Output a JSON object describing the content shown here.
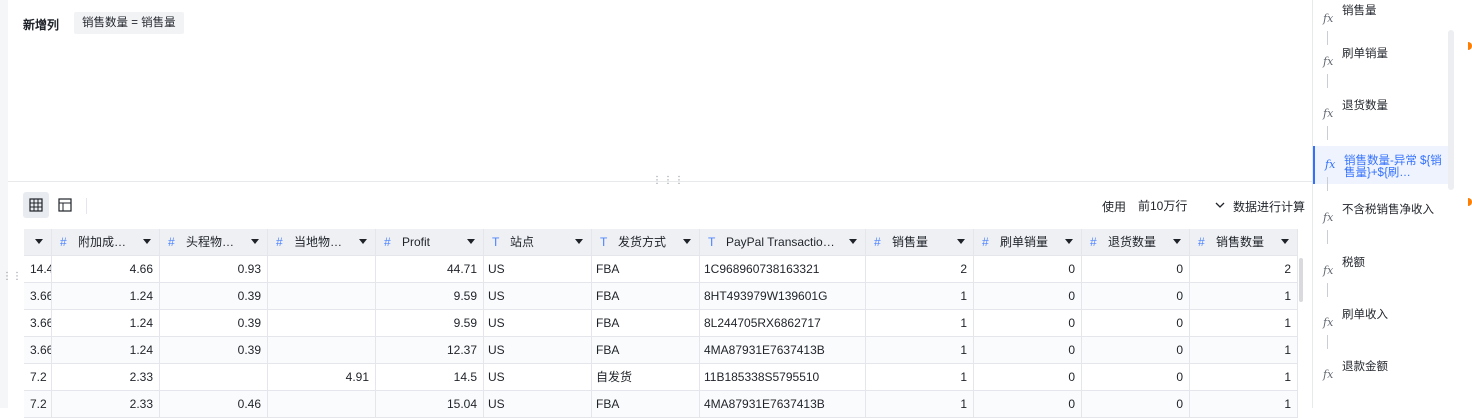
{
  "formula": {
    "label": "新增列",
    "expression": "销售数量 = 销售量"
  },
  "toolbar": {
    "use_label": "使用",
    "select_value": "前10万行",
    "calc_label": "数据进行计算"
  },
  "columns": [
    {
      "name": "",
      "type": "none",
      "align": "num"
    },
    {
      "name": "附加成…",
      "type": "number",
      "align": "num"
    },
    {
      "name": "头程物…",
      "type": "number",
      "align": "num"
    },
    {
      "name": "当地物…",
      "type": "number",
      "align": "num"
    },
    {
      "name": "Profit",
      "type": "number",
      "align": "num"
    },
    {
      "name": "站点",
      "type": "text",
      "align": "txt"
    },
    {
      "name": "发货方式",
      "type": "text",
      "align": "txt"
    },
    {
      "name": "PayPal Transactio…",
      "type": "text",
      "align": "txt"
    },
    {
      "name": "销售量",
      "type": "number",
      "align": "num"
    },
    {
      "name": "刷单销量",
      "type": "number",
      "align": "num"
    },
    {
      "name": "退货数量",
      "type": "number",
      "align": "num"
    },
    {
      "name": "销售数量",
      "type": "number",
      "align": "num"
    }
  ],
  "rows": [
    [
      "14.4",
      "4.66",
      "0.93",
      "",
      "44.71",
      "US",
      "FBA",
      "1C968960738163321",
      "2",
      "0",
      "0",
      "2"
    ],
    [
      "3.66",
      "1.24",
      "0.39",
      "",
      "9.59",
      "US",
      "FBA",
      "8HT493979W139601G",
      "1",
      "0",
      "0",
      "1"
    ],
    [
      "3.66",
      "1.24",
      "0.39",
      "",
      "9.59",
      "US",
      "FBA",
      "8L244705RX6862717",
      "1",
      "0",
      "0",
      "1"
    ],
    [
      "3.66",
      "1.24",
      "0.39",
      "",
      "12.37",
      "US",
      "FBA",
      "4MA87931E7637413B",
      "1",
      "0",
      "0",
      "1"
    ],
    [
      "7.2",
      "2.33",
      "",
      "4.91",
      "14.5",
      "US",
      "自发货",
      "11B185338S5795510",
      "1",
      "0",
      "0",
      "1"
    ],
    [
      "7.2",
      "2.33",
      "0.46",
      "",
      "15.04",
      "US",
      "FBA",
      "4MA87931E7637413B",
      "1",
      "0",
      "0",
      "1"
    ]
  ],
  "sidebar": {
    "items": [
      {
        "label": "销售量",
        "active": false
      },
      {
        "label": "刷单销量",
        "active": false
      },
      {
        "label": "退货数量",
        "active": false
      },
      {
        "label": "销售数量-异常 ${销售量}+${刷…",
        "active": true
      },
      {
        "label": "不含税销售净收入",
        "active": false
      },
      {
        "label": "税额",
        "active": false
      },
      {
        "label": "刷单收入",
        "active": false
      },
      {
        "label": "退款金额",
        "active": false
      }
    ]
  },
  "icons": {
    "grid_view": "grid-view-icon",
    "card_view": "card-view-icon",
    "number_type": "hash-icon",
    "text_type": "text-type-icon",
    "formula": "fx-icon"
  },
  "colors": {
    "accent": "#3370ff",
    "header_bg": "#eef0f4",
    "border": "#e5e6eb"
  }
}
